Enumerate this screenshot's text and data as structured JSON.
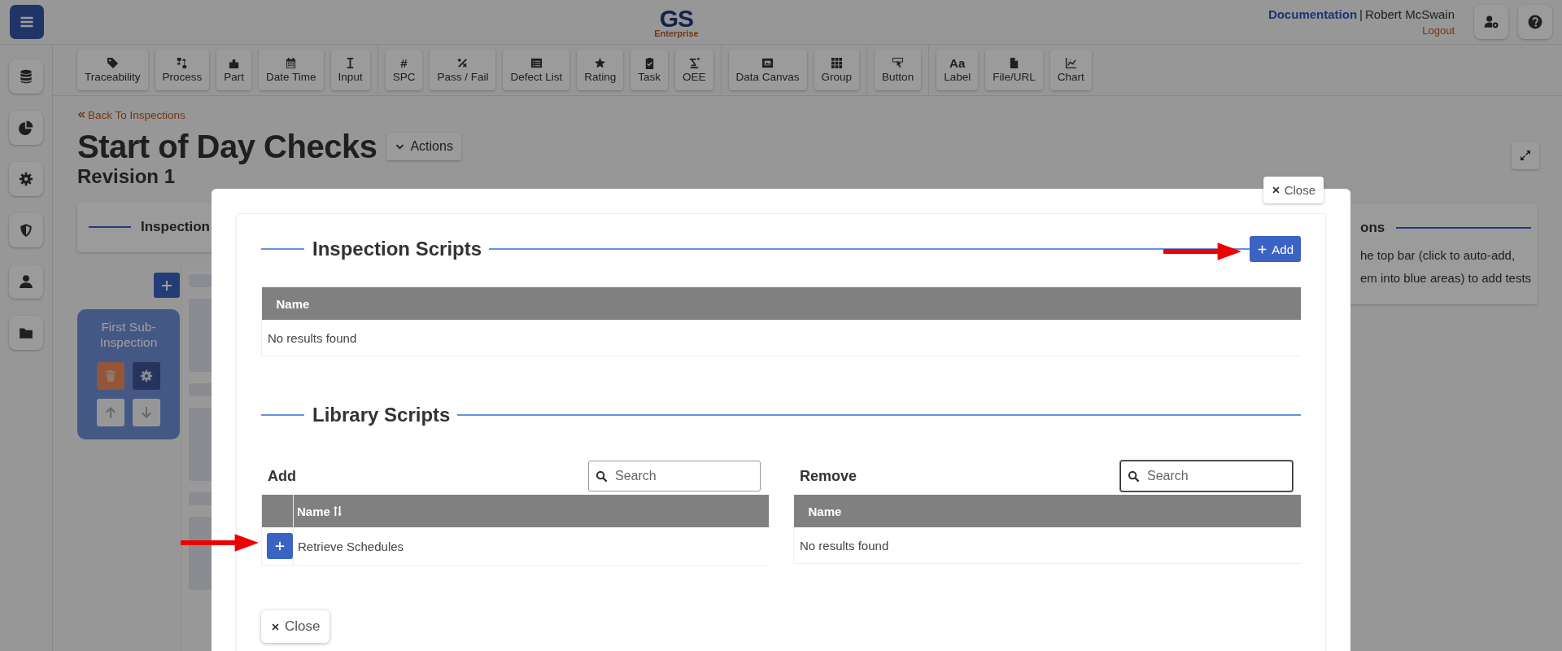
{
  "top_bar": {
    "logo": "GS",
    "logo_subtitle": "Enterprise",
    "documentation_link": "Documentation",
    "separator": "|",
    "user_name": "Robert McSwain",
    "logout_link": "Logout"
  },
  "toolbar": {
    "groups": [
      [
        {
          "label": "Traceability"
        },
        {
          "label": "Process"
        },
        {
          "label": "Part"
        },
        {
          "label": "Date Time"
        },
        {
          "label": "Input"
        }
      ],
      [
        {
          "label": "SPC",
          "glyph": "#"
        },
        {
          "label": "Pass / Fail"
        },
        {
          "label": "Defect List"
        },
        {
          "label": "Rating"
        },
        {
          "label": "Task"
        },
        {
          "label": "OEE"
        }
      ],
      [
        {
          "label": "Data Canvas"
        },
        {
          "label": "Group"
        }
      ],
      [
        {
          "label": "Button"
        }
      ],
      [
        {
          "label": "Label",
          "glyph": "Aa"
        },
        {
          "label": "File/URL"
        },
        {
          "label": "Chart"
        }
      ]
    ]
  },
  "breadcrumb": {
    "back_link": "Back To Inspections"
  },
  "page": {
    "title": "Start of Day Checks",
    "actions_button": "Actions",
    "revision": "Revision 1"
  },
  "background": {
    "left_panel_heading": "Inspection",
    "right_panel_heading": "ons",
    "right_panel_text": [
      "he top bar (click to auto-add,",
      "em into blue areas) to add tests"
    ],
    "sub_inspection": {
      "title": "First Sub-Inspection"
    }
  },
  "modal": {
    "close_tab": "Close",
    "inspection_scripts": {
      "title": "Inspection Scripts",
      "add_button": "Add",
      "columns": [
        "Name"
      ],
      "empty_text": "No results found"
    },
    "library_scripts": {
      "title": "Library Scripts",
      "add_panel": {
        "label": "Add",
        "search_placeholder": "Search",
        "search_focused": false,
        "columns": [
          "Name"
        ],
        "sortable": true,
        "rows": [
          {
            "name": "Retrieve Schedules"
          }
        ]
      },
      "remove_panel": {
        "label": "Remove",
        "search_placeholder": "Search",
        "search_focused": true,
        "columns": [
          "Name"
        ],
        "sortable": false,
        "empty_text": "No results found"
      }
    },
    "close_button": "Close"
  }
}
